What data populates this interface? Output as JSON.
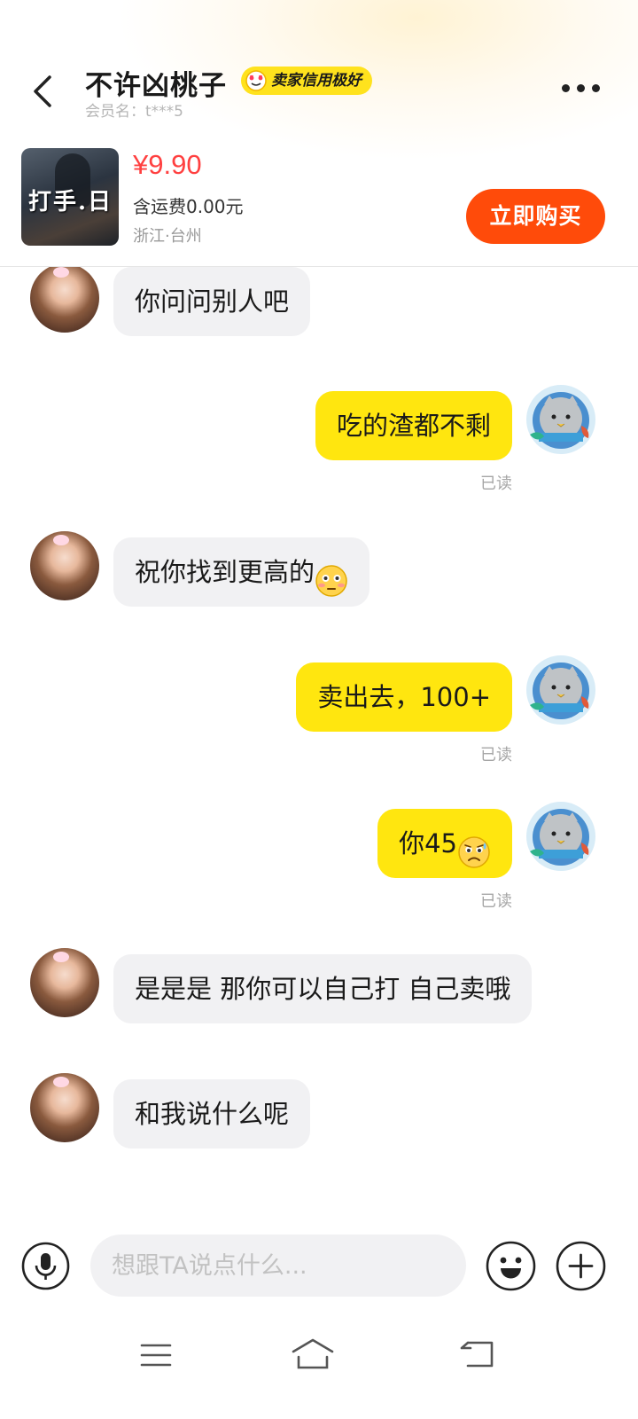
{
  "header": {
    "seller_name": "不许凶桃子",
    "credit_badge": "卖家信用极好",
    "member_name": "会员名：t***5",
    "back_icon": "chevron-left-icon",
    "more_icon": "more-horizontal-icon"
  },
  "product": {
    "thumbnail_text": "打手.日",
    "price": "¥9.90",
    "shipping": "含运费0.00元",
    "location": "浙江·台州",
    "buy_label": "立即购买"
  },
  "messages": [
    {
      "side": "left",
      "text": "你问问别人吧"
    },
    {
      "side": "right",
      "text": "吃的渣都不剩",
      "status": "已读"
    },
    {
      "side": "left",
      "text": "祝你找到更高的",
      "emoji": "flushed-face-emoji"
    },
    {
      "side": "right",
      "text": "卖出去，100+",
      "status": "已读"
    },
    {
      "side": "right",
      "text": "你45",
      "emoji": "anxious-sweat-face-emoji",
      "status": "已读"
    },
    {
      "side": "left",
      "text": "是是是 那你可以自己打 自己卖哦"
    },
    {
      "side": "left",
      "text": "和我说什么呢"
    }
  ],
  "input": {
    "placeholder": "想跟TA说点什么...",
    "value": ""
  },
  "colors": {
    "accent_yellow": "#ffe60f",
    "buy_orange": "#ff4b0a",
    "price_red": "#ff4040",
    "bubble_gray": "#f1f1f3"
  }
}
